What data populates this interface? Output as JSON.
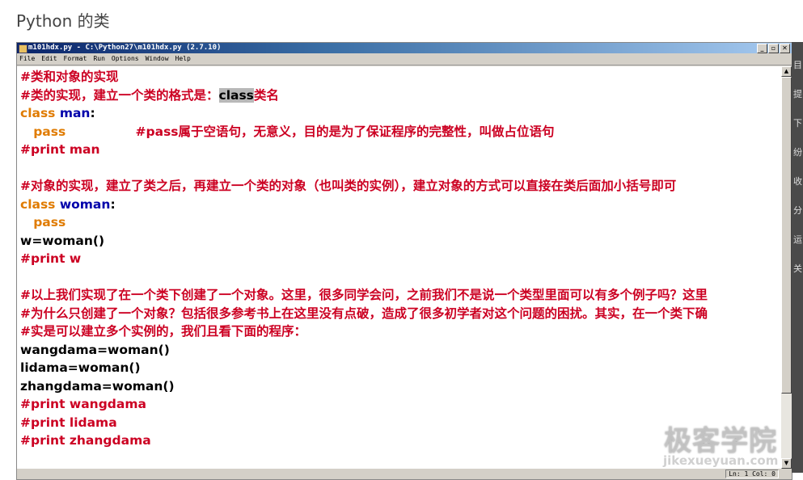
{
  "page_title": "Python 的类",
  "window": {
    "title": "m101hdx.py - C:\\Python27\\m101hdx.py (2.7.10)",
    "buttons": [
      "_",
      "▫",
      "✕"
    ]
  },
  "menu": [
    "File",
    "Edit",
    "Format",
    "Run",
    "Options",
    "Window",
    "Help"
  ],
  "code_lines": [
    [
      {
        "t": "c",
        "s": "#类和对象的实现"
      }
    ],
    [
      {
        "t": "c",
        "s": "#类的实现，建立一个类的格式是："
      },
      {
        "t": "h",
        "s": "class"
      },
      {
        "t": "c",
        "s": "类名"
      }
    ],
    [
      {
        "t": "k",
        "s": "class "
      },
      {
        "t": "n",
        "s": "man"
      },
      {
        "t": "p",
        "s": ":"
      }
    ],
    [
      {
        "t": "k",
        "s": "   pass"
      },
      {
        "t": "c",
        "s": "                #pass属于空语句，无意义，目的是为了保证程序的完整性，叫做占位语句"
      }
    ],
    [
      {
        "t": "c",
        "s": "#print man"
      }
    ],
    [],
    [
      {
        "t": "c",
        "s": "#对象的实现，建立了类之后，再建立一个类的对象（也叫类的实例），建立对象的方式可以直接在类后面加小括号即可"
      }
    ],
    [
      {
        "t": "k",
        "s": "class "
      },
      {
        "t": "n",
        "s": "woman"
      },
      {
        "t": "p",
        "s": ":"
      }
    ],
    [
      {
        "t": "k",
        "s": "   pass"
      }
    ],
    [
      {
        "t": "p",
        "s": "w=woman()"
      }
    ],
    [
      {
        "t": "c",
        "s": "#print w"
      }
    ],
    [],
    [
      {
        "t": "c",
        "s": "#以上我们实现了在一个类下创建了一个对象。这里，很多同学会问，之前我们不是说一个类型里面可以有多个例子吗？这里"
      }
    ],
    [
      {
        "t": "c",
        "s": "#为什么只创建了一个对象？包括很多参考书上在这里没有点破，造成了很多初学者对这个问题的困扰。其实，在一个类下确"
      }
    ],
    [
      {
        "t": "c",
        "s": "#实是可以建立多个实例的，我们且看下面的程序："
      }
    ],
    [
      {
        "t": "p",
        "s": "wangdama=woman()"
      }
    ],
    [
      {
        "t": "p",
        "s": "lidama=woman()"
      }
    ],
    [
      {
        "t": "p",
        "s": "zhangdama=woman()"
      }
    ],
    [
      {
        "t": "c",
        "s": "#print wangdama"
      }
    ],
    [
      {
        "t": "c",
        "s": "#print lidama"
      }
    ],
    [
      {
        "t": "c",
        "s": "#print zhangdama"
      }
    ]
  ],
  "status": "Ln: 1 Col: 0",
  "watermark": {
    "cn": "极客学院",
    "url": "jikexueyuan.com"
  },
  "sidebar_glyphs": [
    "目",
    "提",
    "下",
    "纷",
    "收",
    "分",
    "运",
    "关"
  ]
}
